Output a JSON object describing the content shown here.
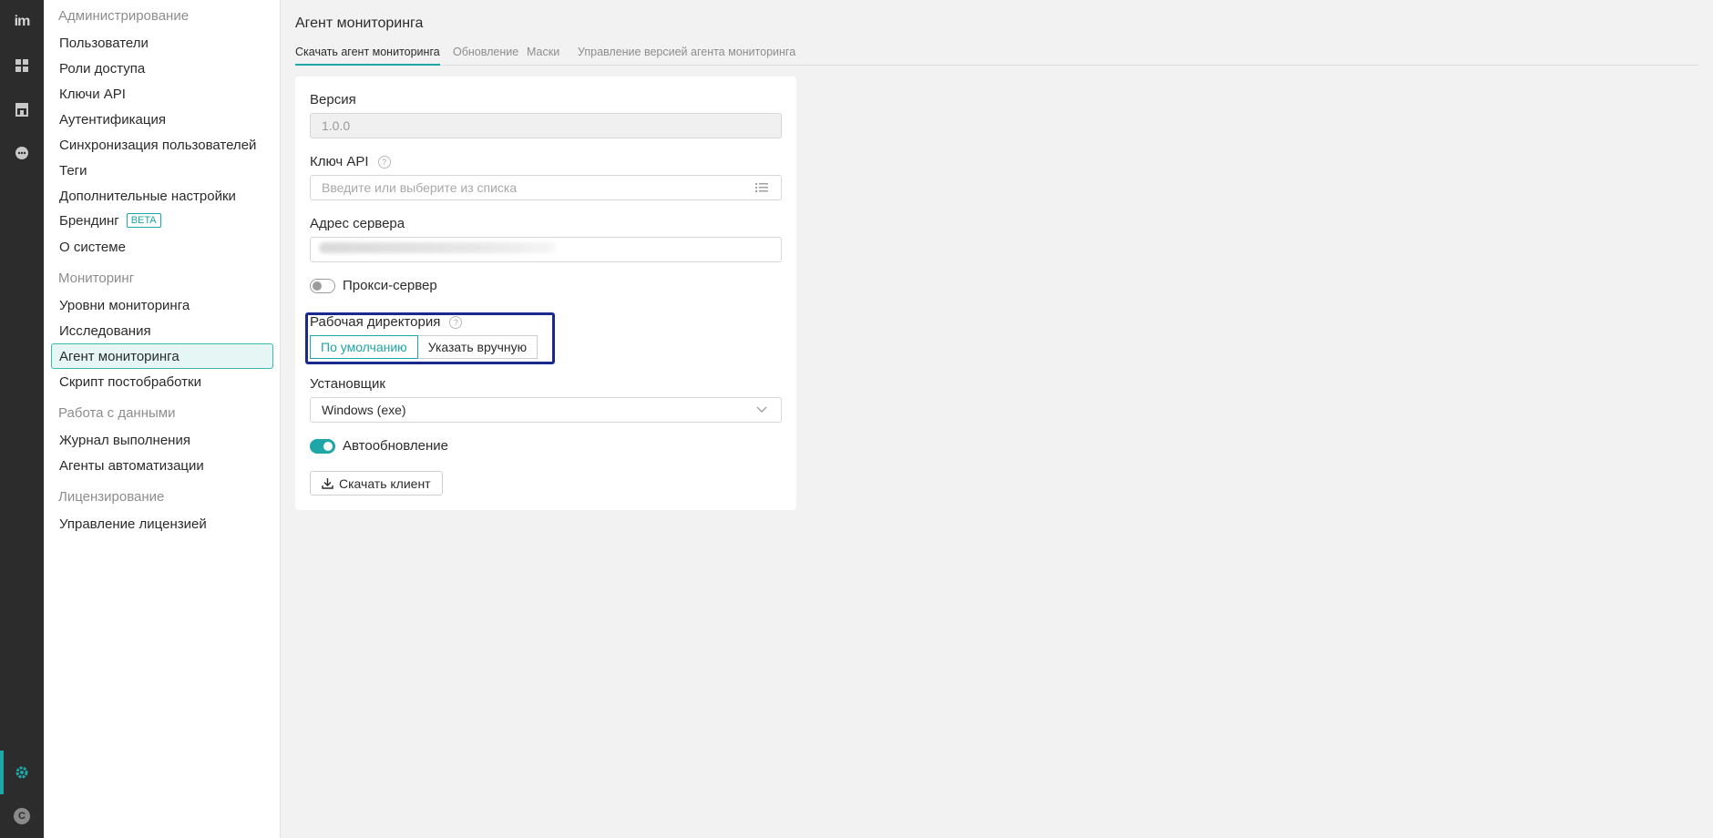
{
  "rail": {
    "logo": "im",
    "avatar_letter": "C",
    "accent": "#1fa6a6"
  },
  "sidebar": {
    "groups": [
      {
        "title": "Администрирование",
        "items": [
          {
            "label": "Пользователи"
          },
          {
            "label": "Роли доступа"
          },
          {
            "label": "Ключи API"
          },
          {
            "label": "Аутентификация"
          },
          {
            "label": "Синхронизация пользователей"
          },
          {
            "label": "Теги"
          },
          {
            "label": "Дополнительные настройки"
          },
          {
            "label": "Брендинг",
            "badge": "BETA"
          },
          {
            "label": "О системе"
          }
        ]
      },
      {
        "title": "Мониторинг",
        "items": [
          {
            "label": "Уровни мониторинга"
          },
          {
            "label": "Исследования"
          },
          {
            "label": "Агент мониторинга",
            "active": true
          },
          {
            "label": "Скрипт постобработки"
          }
        ]
      },
      {
        "title": "Работа с данными",
        "items": [
          {
            "label": "Журнал выполнения"
          },
          {
            "label": "Агенты автоматизации"
          }
        ]
      },
      {
        "title": "Лицензирование",
        "items": [
          {
            "label": "Управление лицензией"
          }
        ]
      }
    ]
  },
  "main": {
    "title": "Агент мониторинга",
    "tabs": [
      {
        "label": "Скачать агент мониторинга",
        "active": true
      },
      {
        "label": "Обновление"
      },
      {
        "label": "Маски"
      },
      {
        "label": "Управление версией агента мониторинга"
      }
    ],
    "form": {
      "version_label": "Версия",
      "version_value": "1.0.0",
      "api_key_label": "Ключ API",
      "api_key_placeholder": "Введите или выберите из списка",
      "server_label": "Адрес сервера",
      "proxy_label": "Прокси-сервер",
      "proxy_enabled": false,
      "workdir_label": "Рабочая директория",
      "workdir_options": [
        "По умолчанию",
        "Указать вручную"
      ],
      "workdir_selected": "По умолчанию",
      "installer_label": "Установщик",
      "installer_value": "Windows (exe)",
      "autoupdate_label": "Автообновление",
      "autoupdate_enabled": true,
      "download_button": "Скачать клиент"
    }
  }
}
